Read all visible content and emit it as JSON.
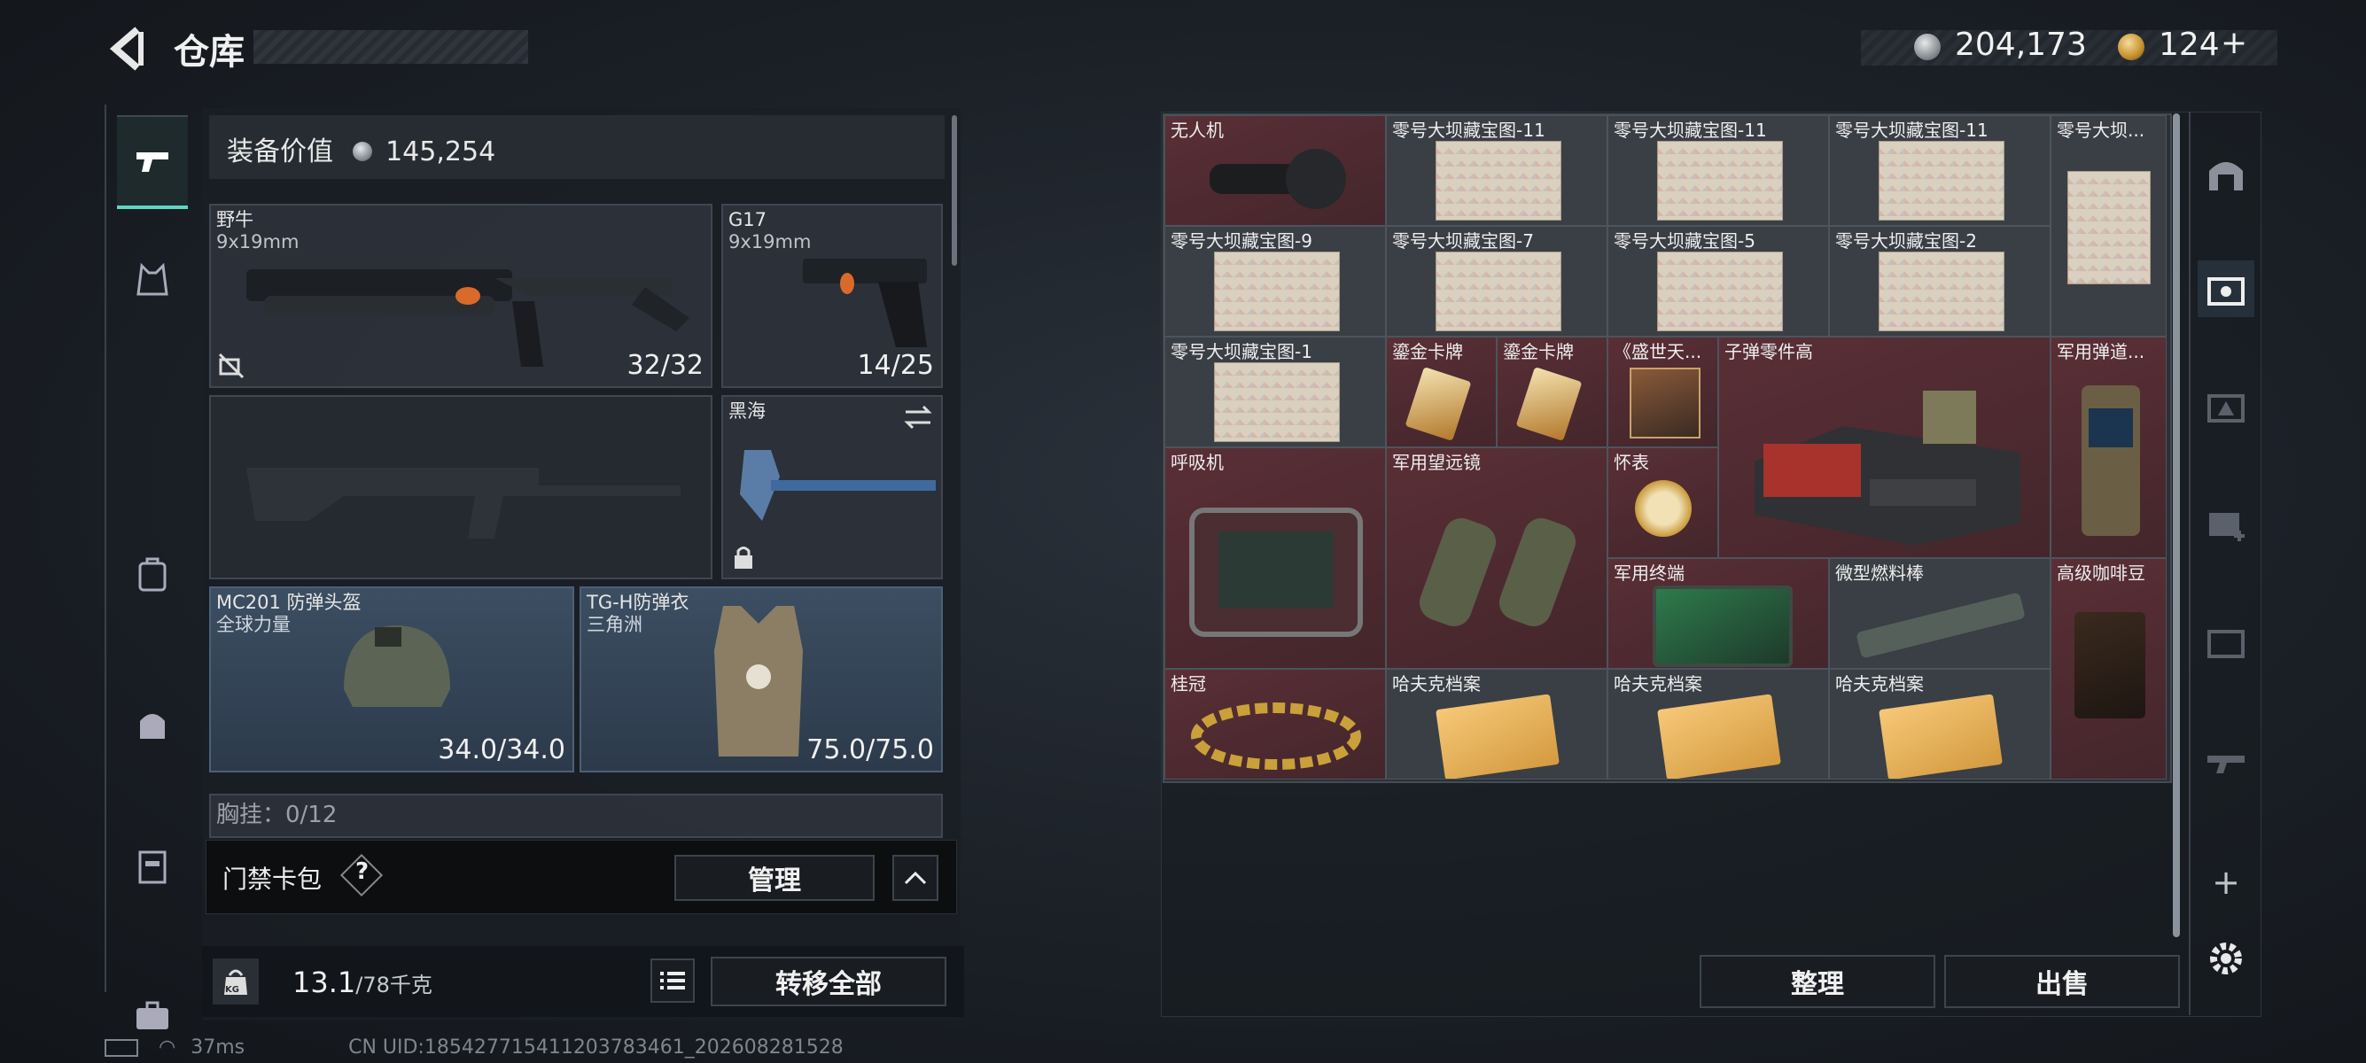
{
  "header": {
    "title": "仓库",
    "currency_silver": "204,173",
    "currency_gold": "124",
    "gold_add": "+"
  },
  "equipment": {
    "value_label": "装备价值",
    "value": "145,254",
    "primary": {
      "name": "野牛",
      "caliber": "9x19mm",
      "ammo": "32/32"
    },
    "sidearm": {
      "name": "G17",
      "caliber": "9x19mm",
      "ammo": "14/25"
    },
    "melee": {
      "name": "黑海"
    },
    "helmet": {
      "name": "MC201 防弹头盔",
      "tag": "全球力量",
      "durability": "34.0/34.0"
    },
    "armor": {
      "name": "TG-H防弹衣",
      "tag": "三角洲",
      "durability": "75.0/75.0"
    },
    "chest_rig": "胸挂：0/12",
    "cardpack_label": "门禁卡包",
    "help_symbol": "?",
    "manage_label": "管理",
    "weight": "13.1",
    "weight_max": "/78千克",
    "transfer_all": "转移全部",
    "weight_icon_text": "KG"
  },
  "stash": {
    "items": [
      "无人机",
      "零号大坝藏宝图-11",
      "零号大坝藏宝图-11",
      "零号大坝藏宝图-11",
      "零号大坝...",
      "零号大坝藏宝图-9",
      "零号大坝藏宝图-7",
      "零号大坝藏宝图-5",
      "零号大坝藏宝图-2",
      "零号大坝藏宝图-1",
      "鎏金卡牌",
      "鎏金卡牌",
      "《盛世天...",
      "子弹零件高",
      "军用弹道...",
      "呼吸机",
      "军用望远镜",
      "怀表",
      "军用终端",
      "微型燃料棒",
      "高级咖啡豆",
      "桂冠",
      "哈夫克档案",
      "哈夫克档案",
      "哈夫克档案"
    ],
    "sort_label": "整理",
    "sell_label": "出售",
    "add_symbol": "+"
  },
  "status": {
    "ping": "37ms",
    "uid": "CN UID:18542771541120378346­1_202608281528"
  },
  "colors": {
    "accent": "#5fd6c4",
    "red_cell": "#5a2f36",
    "gold": "#c48f2c"
  }
}
